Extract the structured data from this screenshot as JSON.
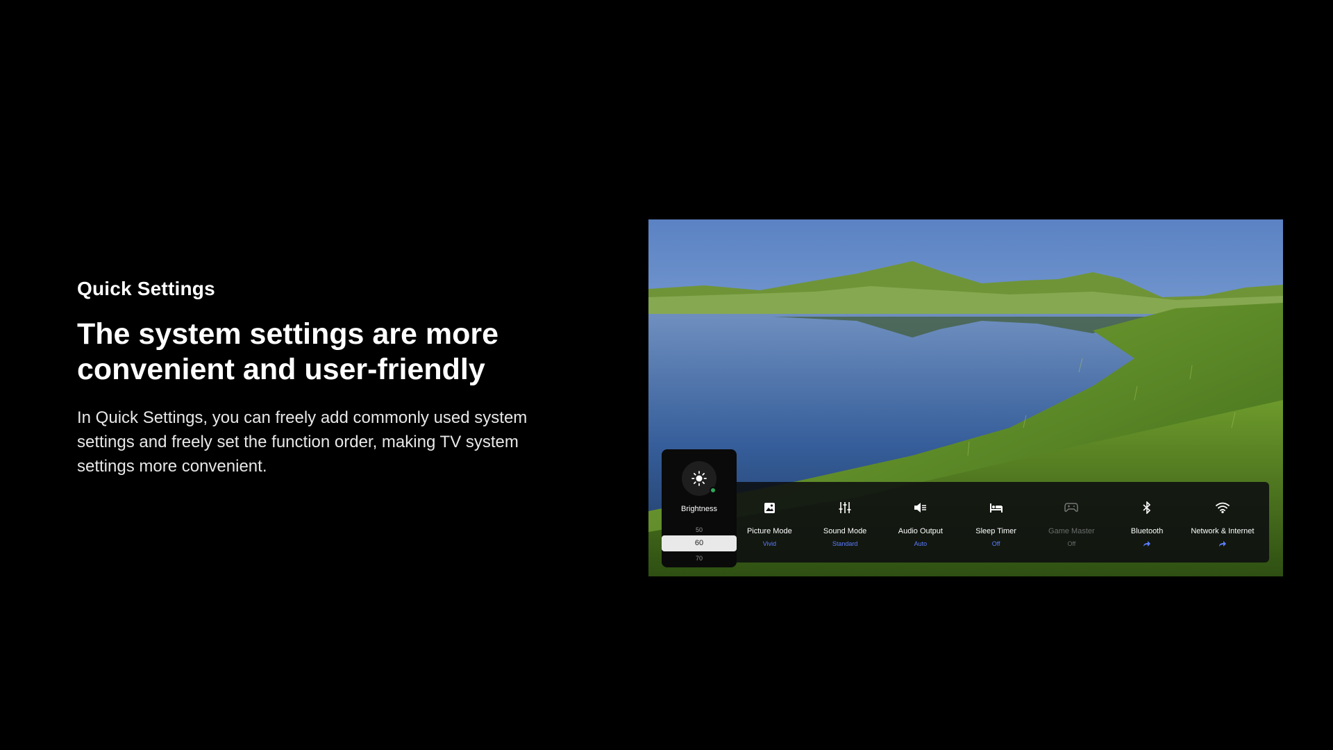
{
  "intro": {
    "eyebrow": "Quick Settings",
    "headline": "The system settings are more convenient and user-friendly",
    "description": "In Quick Settings, you can freely add commonly used system settings and freely set the function order, making TV system settings more convenient."
  },
  "brightness": {
    "label": "Brightness",
    "icon": "sun-icon",
    "values": {
      "below": "50",
      "selected": "60",
      "above": "70"
    }
  },
  "quick_settings": [
    {
      "label": "Picture Mode",
      "value": "Vivid",
      "icon": "picture-icon",
      "enabled": true
    },
    {
      "label": "Sound Mode",
      "value": "Standard",
      "icon": "equalizer-icon",
      "enabled": true
    },
    {
      "label": "Audio Output",
      "value": "Auto",
      "icon": "speaker-icon",
      "enabled": true
    },
    {
      "label": "Sleep Timer",
      "value": "Off",
      "icon": "bed-icon",
      "enabled": true
    },
    {
      "label": "Game Master",
      "value": "Off",
      "icon": "gamepad-icon",
      "enabled": false
    },
    {
      "label": "Bluetooth",
      "value": "",
      "icon": "bluetooth-icon",
      "enabled": true,
      "value_icon": "arrow-forward-icon"
    },
    {
      "label": "Network & Internet",
      "value": "",
      "icon": "wifi-icon",
      "enabled": true,
      "value_icon": "arrow-forward-icon"
    }
  ],
  "colors": {
    "background": "#000000",
    "value_accent": "#5c7dff",
    "status_dot": "#2fa85a"
  }
}
